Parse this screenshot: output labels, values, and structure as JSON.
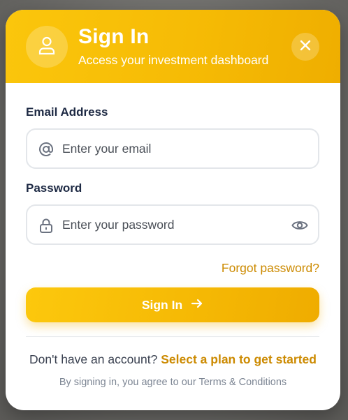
{
  "header": {
    "title": "Sign In",
    "subtitle": "Access your investment dashboard",
    "avatar_icon": "user-icon",
    "close_icon": "close-icon"
  },
  "form": {
    "email": {
      "label": "Email Address",
      "placeholder": "Enter your email",
      "value": "",
      "icon": "at-sign-icon"
    },
    "password": {
      "label": "Password",
      "placeholder": "Enter your password",
      "value": "",
      "icon": "lock-icon",
      "toggle_icon": "eye-icon"
    },
    "forgot_label": "Forgot password?",
    "submit_label": "Sign In",
    "submit_icon": "arrow-right-icon"
  },
  "footer": {
    "signup_prompt": "Don't have an account?",
    "signup_link": "Select a plan to get started",
    "terms_text": "By signing in, you agree to our Terms & Conditions"
  },
  "colors": {
    "accent": "#f6bb05",
    "link": "#cc8a00",
    "label": "#1e2a44"
  }
}
